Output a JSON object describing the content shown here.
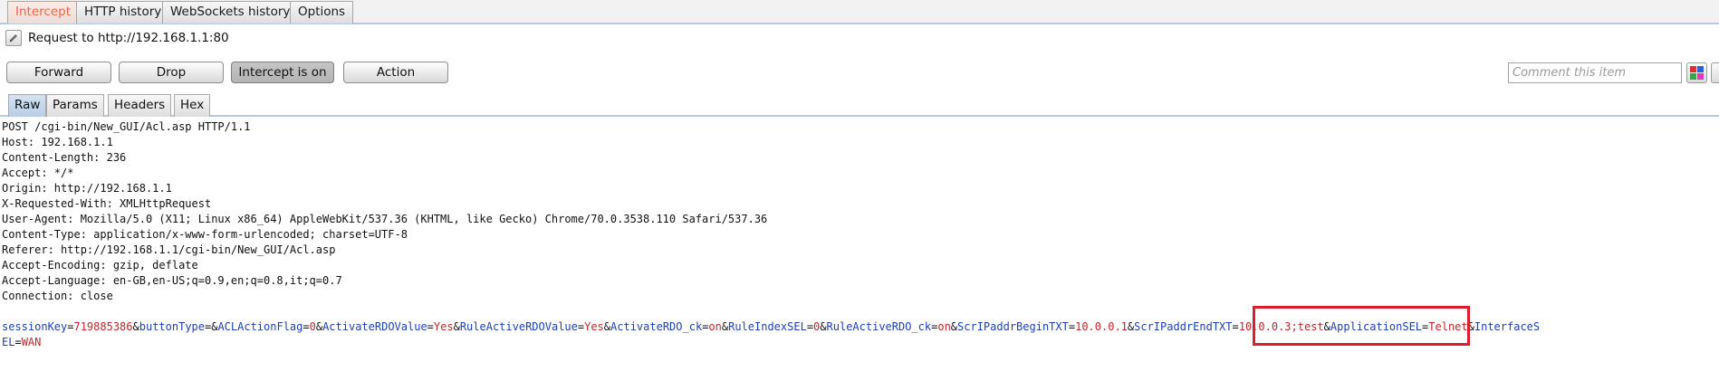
{
  "top_tabs": [
    "Intercept",
    "HTTP history",
    "WebSockets history",
    "Options"
  ],
  "request_label": "Request to http://192.168.1.1:80",
  "buttons": {
    "forward": "Forward",
    "drop": "Drop",
    "intercept": "Intercept is on",
    "action": "Action"
  },
  "comment_placeholder": "Comment this item",
  "sub_tabs": [
    "Raw",
    "Params",
    "Headers",
    "Hex"
  ],
  "request_lines": [
    "POST /cgi-bin/New_GUI/Acl.asp HTTP/1.1",
    "Host: 192.168.1.1",
    "Content-Length: 236",
    "Accept: */*",
    "Origin: http://192.168.1.1",
    "X-Requested-With: XMLHttpRequest",
    "User-Agent: Mozilla/5.0 (X11; Linux x86_64) AppleWebKit/537.36 (KHTML, like Gecko) Chrome/70.0.3538.110 Safari/537.36",
    "Content-Type: application/x-www-form-urlencoded; charset=UTF-8",
    "Referer: http://192.168.1.1/cgi-bin/New_GUI/Acl.asp",
    "Accept-Encoding: gzip, deflate",
    "Accept-Language: en-GB,en-US;q=0.9,en;q=0.8,it;q=0.7",
    "Connection: close"
  ],
  "body_line1": [
    {
      "t": "k",
      "s": "sessionKey"
    },
    {
      "t": "p",
      "s": "="
    },
    {
      "t": "v",
      "s": "719885386"
    },
    {
      "t": "p",
      "s": "&"
    },
    {
      "t": "k",
      "s": "buttonType"
    },
    {
      "t": "p",
      "s": "=&"
    },
    {
      "t": "k",
      "s": "ACLActionFlag"
    },
    {
      "t": "p",
      "s": "="
    },
    {
      "t": "v",
      "s": "0"
    },
    {
      "t": "p",
      "s": "&"
    },
    {
      "t": "k",
      "s": "ActivateRDOValue"
    },
    {
      "t": "p",
      "s": "="
    },
    {
      "t": "v",
      "s": "Yes"
    },
    {
      "t": "p",
      "s": "&"
    },
    {
      "t": "k",
      "s": "RuleActiveRDOValue"
    },
    {
      "t": "p",
      "s": "="
    },
    {
      "t": "v",
      "s": "Yes"
    },
    {
      "t": "p",
      "s": "&"
    },
    {
      "t": "k",
      "s": "ActivateRDO_ck"
    },
    {
      "t": "p",
      "s": "="
    },
    {
      "t": "v",
      "s": "on"
    },
    {
      "t": "p",
      "s": "&"
    },
    {
      "t": "k",
      "s": "RuleIndexSEL"
    },
    {
      "t": "p",
      "s": "="
    },
    {
      "t": "v",
      "s": "0"
    },
    {
      "t": "p",
      "s": "&"
    },
    {
      "t": "k",
      "s": "RuleActiveRDO_ck"
    },
    {
      "t": "p",
      "s": "="
    },
    {
      "t": "v",
      "s": "on"
    },
    {
      "t": "p",
      "s": "&"
    },
    {
      "t": "k",
      "s": "ScrIPaddrBeginTXT"
    },
    {
      "t": "p",
      "s": "="
    },
    {
      "t": "v",
      "s": "10.0.0.1"
    },
    {
      "t": "p",
      "s": "&"
    },
    {
      "t": "k",
      "s": "ScrIPaddrEndTXT"
    },
    {
      "t": "p",
      "s": "="
    },
    {
      "t": "v",
      "s": "10.0.0.3;test"
    },
    {
      "t": "p",
      "s": "&"
    },
    {
      "t": "k",
      "s": "ApplicationSEL"
    },
    {
      "t": "p",
      "s": "="
    },
    {
      "t": "v",
      "s": "Telnet"
    },
    {
      "t": "p",
      "s": "&"
    },
    {
      "t": "k",
      "s": "InterfaceS"
    }
  ],
  "body_line2": [
    {
      "t": "k",
      "s": "EL"
    },
    {
      "t": "p",
      "s": "="
    },
    {
      "t": "v",
      "s": "WAN"
    }
  ],
  "colors": {
    "param_key": "#1f3fb8",
    "param_value": "#c1272d",
    "highlight_box": "#dd1c2c",
    "active_intercept_tab": "#e8664a"
  }
}
